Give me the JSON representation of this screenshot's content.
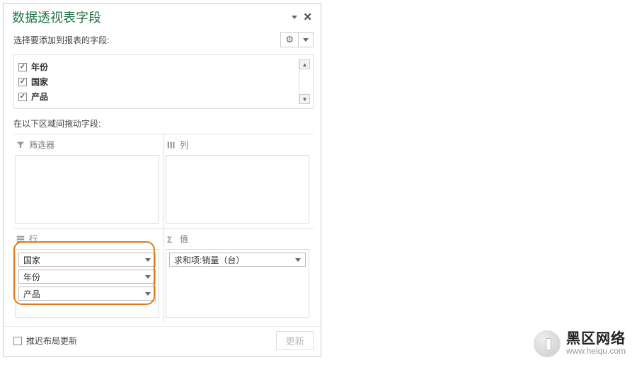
{
  "pane": {
    "title": "数据透视表字段",
    "select_fields_label": "选择要添加到报表的字段:",
    "drag_label": "在以下区域间拖动字段:"
  },
  "fields": [
    {
      "label": "年份",
      "checked": true
    },
    {
      "label": "国家",
      "checked": true
    },
    {
      "label": "产品",
      "checked": true
    }
  ],
  "areas": {
    "filters": {
      "label": "筛选器",
      "items": []
    },
    "columns": {
      "label": "列",
      "items": []
    },
    "rows": {
      "label": "行",
      "items": [
        "国家",
        "年份",
        "产品"
      ]
    },
    "values": {
      "label": "值",
      "items": [
        "求和项:销量（台）"
      ]
    }
  },
  "footer": {
    "defer_label": "推迟布局更新",
    "update_label": "更新"
  },
  "watermark": {
    "main": "黑区网络",
    "sub": "www.heiqu.com"
  }
}
